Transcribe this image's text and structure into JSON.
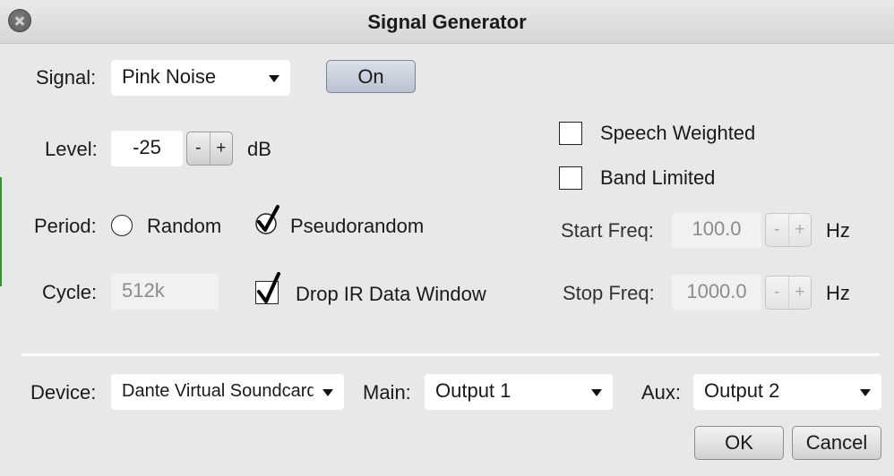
{
  "window": {
    "title": "Signal Generator"
  },
  "signal": {
    "label": "Signal:",
    "value": "Pink Noise",
    "on_button": "On"
  },
  "level": {
    "label": "Level:",
    "value": "-25",
    "minus": "-",
    "plus": "+",
    "unit": "dB"
  },
  "period": {
    "label": "Period:",
    "options": [
      {
        "label": "Random",
        "selected": false
      },
      {
        "label": "Pseudorandom",
        "selected": true
      }
    ]
  },
  "cycle": {
    "label": "Cycle:",
    "value": "512k"
  },
  "drop_ir": {
    "label": "Drop IR Data Window",
    "checked": true
  },
  "speech_weighted": {
    "label": "Speech Weighted",
    "checked": false
  },
  "band_limited": {
    "label": "Band Limited",
    "checked": false
  },
  "start_freq": {
    "label": "Start Freq:",
    "value": "100.0",
    "minus": "-",
    "plus": "+",
    "unit": "Hz"
  },
  "stop_freq": {
    "label": "Stop Freq:",
    "value": "1000.0",
    "minus": "-",
    "plus": "+",
    "unit": "Hz"
  },
  "device": {
    "label": "Device:",
    "value": "Dante Virtual Soundcard"
  },
  "main": {
    "label": "Main:",
    "value": "Output 1"
  },
  "aux": {
    "label": "Aux:",
    "value": "Output 2"
  },
  "buttons": {
    "ok": "OK",
    "cancel": "Cancel"
  },
  "colors": {
    "background": "#e8e8e8",
    "field": "#ffffff",
    "disabled_text": "#8c8c8c",
    "window_edge_accent": "#2a9a2a"
  }
}
